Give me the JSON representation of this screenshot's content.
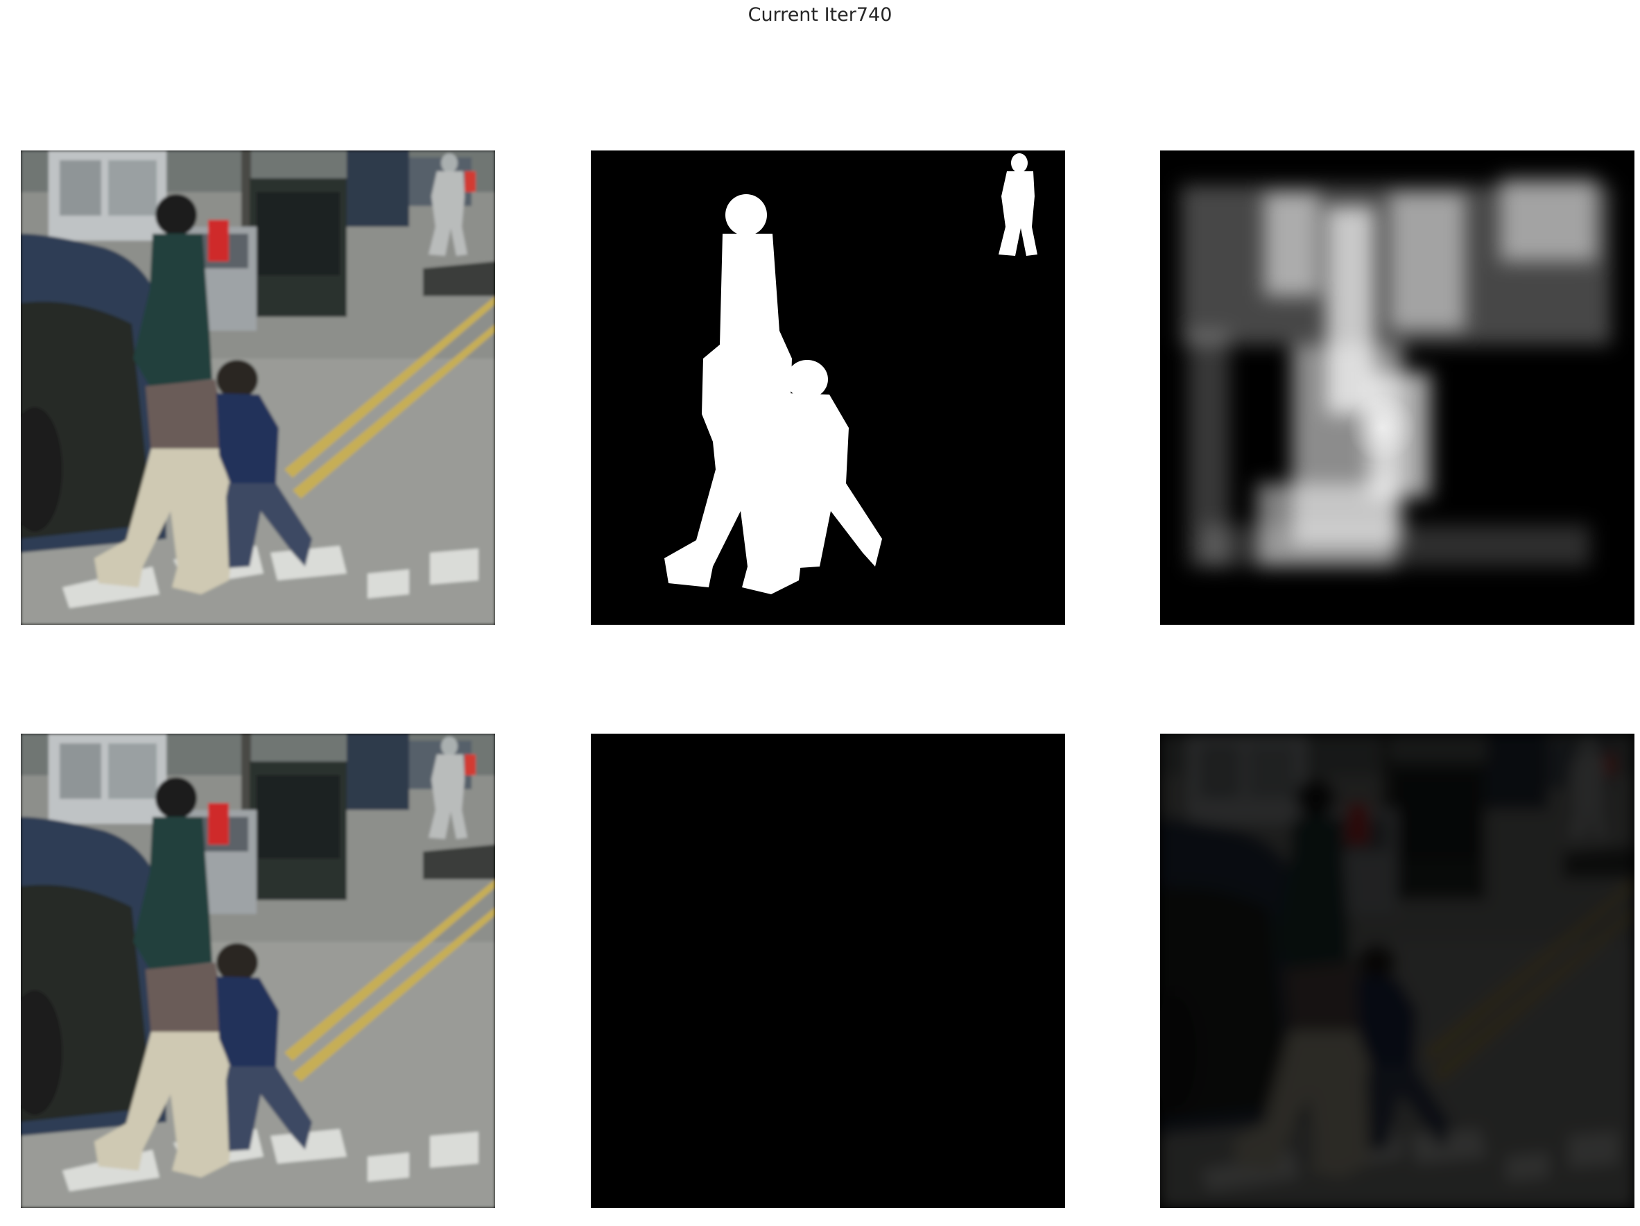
{
  "figure": {
    "title": "Current Iter740"
  }
}
